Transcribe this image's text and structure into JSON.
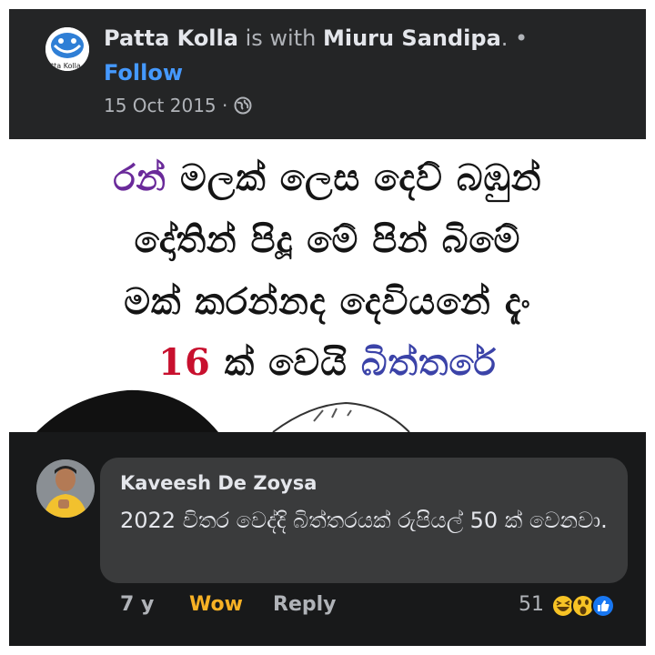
{
  "post": {
    "page_name": "Patta Kolla",
    "with_text": "is with",
    "tagged_name": "Miuru Sandipa",
    "dot": ". •",
    "follow_label": "Follow",
    "date": "15 Oct 2015 ·",
    "avatar_text": "tta Kolla",
    "avatar_icon": "troll-face-logo",
    "privacy_icon": "globe-icon"
  },
  "image": {
    "line1_a": "රන්",
    "line1_b": "මලක් ලෙස දෙව් බඹුන්",
    "line2": "දෝතින් පිදූ මේ පින් බිමේ",
    "line3": "මක් කරන්නද දෙවියනේ දැං",
    "line4_num": "16",
    "line4_mid": "ක් වෙයි",
    "line4_end": "බිත්තරේ"
  },
  "comment": {
    "author": "Kaveesh De Zoysa",
    "text": "2022 විතර වෙද්දි බිත්තරයක් රුපියල් 50 ක් වෙනවා.",
    "time": "7 y",
    "wow_label": "Wow",
    "reply_label": "Reply",
    "reaction_count": "51",
    "reaction_icons": [
      "haha-icon",
      "wow-icon",
      "like-icon"
    ]
  },
  "colors": {
    "panel_dark": "#242526",
    "comment_bg": "#18191a",
    "bubble": "#3a3b3c",
    "link_blue": "#4599ff",
    "wow_yellow": "#f7b125",
    "text_purple": "#6a2a9a",
    "text_red": "#c8102e",
    "text_blue": "#3b43a8"
  }
}
